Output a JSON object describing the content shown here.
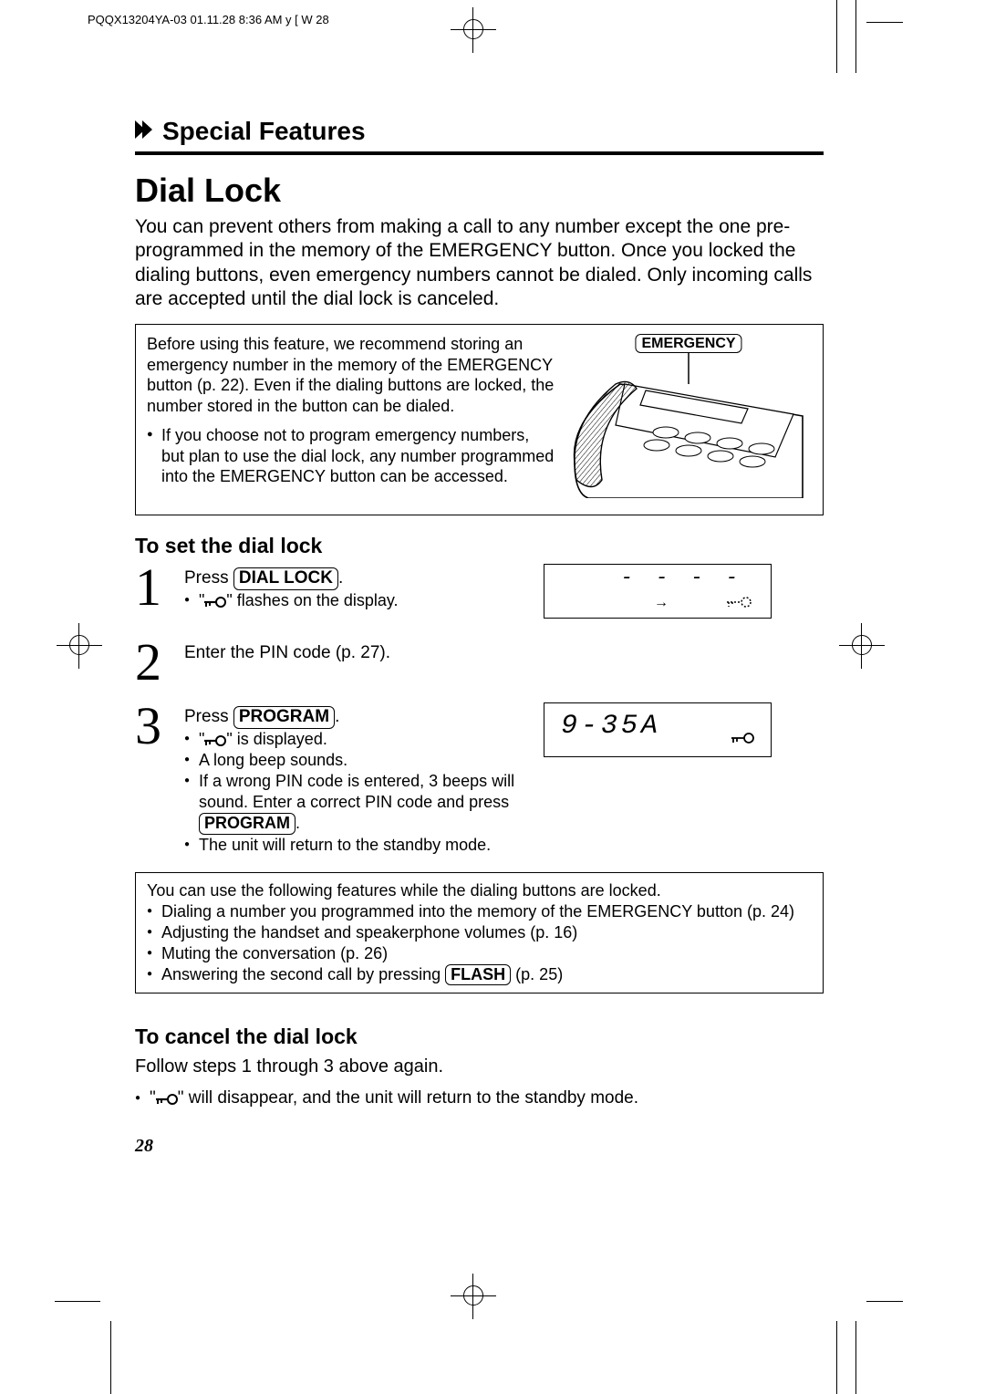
{
  "slug": "PQQX13204YA-03  01.11.28 8:36 AM   y [ W  28",
  "section_title": "Special Features",
  "title": "Dial Lock",
  "intro": "You can prevent others from making a call to any number except the one pre-programmed in the memory of the EMERGENCY button. Once you locked the dialing buttons, even emergency numbers cannot be dialed. Only incoming calls are accepted until the dial lock is canceled.",
  "inset": {
    "rec": "Before using this feature, we recommend storing an emergency number in the memory of the EMERGENCY button (p. 22). Even if the dialing buttons are locked, the number stored in the button can be dialed.",
    "bullet": "If you choose not to program emergency numbers, but plan to use the dial lock, any number programmed into the EMERGENCY button can be accessed.",
    "emergency_label": "EMERGENCY"
  },
  "set_heading": "To set the dial lock",
  "steps": {
    "s1": {
      "press": "Press ",
      "btn": "DIAL LOCK",
      "period": ".",
      "sub_prefix": "\"",
      "sub_suffix": "\" flashes on the display."
    },
    "s2": {
      "text": "Enter the PIN code (p. 27)."
    },
    "s3": {
      "press": "Press ",
      "btn": "PROGRAM",
      "period": ".",
      "sub1_prefix": "\"",
      "sub1_suffix": "\" is displayed.",
      "sub2": "A long beep sounds.",
      "sub3a": "If a wrong PIN code is entered, 3 beeps will sound. Enter a correct PIN code and press ",
      "sub3b": "PROGRAM",
      "sub3c": ".",
      "sub4": "The unit will return to the standby mode."
    }
  },
  "display1": {
    "dashes": "- - - -",
    "arrow": "→"
  },
  "display2": {
    "num": "9-35A"
  },
  "notes": {
    "lead": "You can use the following features while the dialing buttons are locked.",
    "n1": "Dialing a number you programmed into the memory of the EMERGENCY button (p. 24)",
    "n2": "Adjusting the handset and speakerphone volumes (p. 16)",
    "n3": "Muting the conversation (p. 26)",
    "n4a": "Answering the second call by pressing ",
    "n4b": "FLASH",
    "n4c": " (p. 25)"
  },
  "cancel_heading": "To cancel the dial lock",
  "cancel_text": "Follow steps 1 through 3 above again.",
  "cancel_bullet_prefix": "\"",
  "cancel_bullet_suffix": "\" will disappear, and the unit will return to the standby mode.",
  "page_number": "28"
}
